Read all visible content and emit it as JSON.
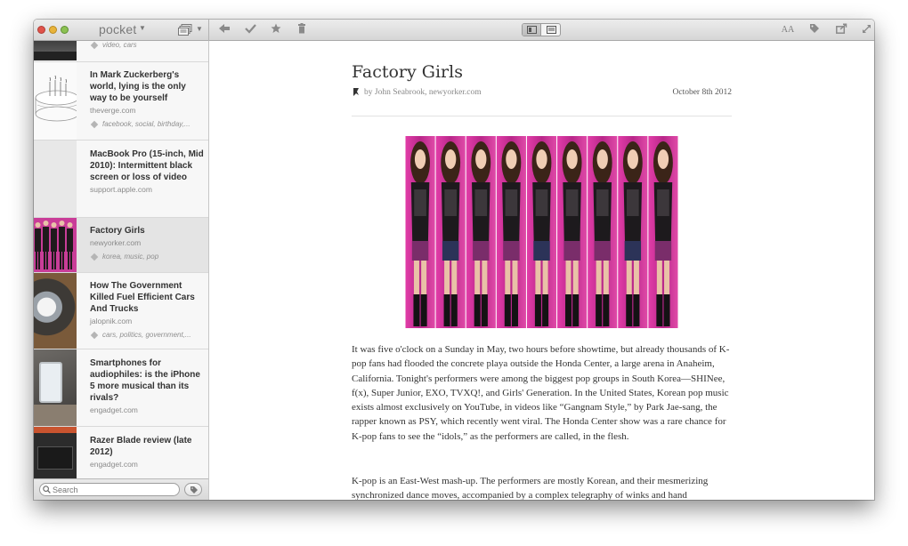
{
  "app": {
    "title": "pocket"
  },
  "toolbar": {
    "buttons": [
      "back-icon",
      "mark-read-icon",
      "favorite-icon",
      "delete-icon"
    ],
    "right_buttons": [
      "text-size-icon",
      "tag-icon",
      "share-icon",
      "fullscreen-icon"
    ],
    "text_size_label": "AA"
  },
  "sidebar": {
    "items": [
      {
        "title": "",
        "domain": "",
        "tags": "video, cars"
      },
      {
        "title": "In Mark Zuckerberg's world, lying is the only way to be yourself",
        "domain": "theverge.com",
        "tags": "facebook, social, birthday,..."
      },
      {
        "title": "MacBook Pro (15-inch, Mid 2010): Intermittent black screen or loss of video",
        "domain": "support.apple.com",
        "tags": ""
      },
      {
        "title": "Factory Girls",
        "domain": "newyorker.com",
        "tags": "korea, music, pop"
      },
      {
        "title": "How The Government Killed Fuel Efficient Cars And Trucks",
        "domain": "jalopnik.com",
        "tags": "cars, politics, government,..."
      },
      {
        "title": "Smartphones for audiophiles: is the iPhone 5 more musical than its rivals?",
        "domain": "engadget.com",
        "tags": ""
      },
      {
        "title": "Razer Blade review (late 2012)",
        "domain": "engadget.com",
        "tags": ""
      }
    ],
    "search": {
      "placeholder": "Search"
    }
  },
  "article": {
    "title": "Factory Girls",
    "byline": "by John Seabrook, newyorker.com",
    "date": "October 8th 2012",
    "paragraphs": [
      "It was five o'clock on a Sunday in May, two hours before showtime, but already thousands of K-pop fans had flooded the concrete playa outside the Honda Center, a large arena in Anaheim, California. Tonight's performers were among the biggest pop groups in South Korea—SHINee, f(x), Super Junior, EXO, TVXQ!, and Girls' Generation. In the United States, Korean pop music exists almost exclusively on YouTube, in videos like “Gangnam Style,” by Park Jae-sang, the rapper known as PSY, which recently went viral. The Honda Center show was a rare chance for K-pop fans to see the “idols,” as the performers are called, in the flesh.",
      "K-pop is an East-West mash-up. The performers are mostly Korean, and their mesmerizing synchronized dance moves, accompanied by a complex telegraphy of winks and hand"
    ]
  },
  "colors": {
    "accent_pink": "#c8389a",
    "selected_row": "#e4e4e4"
  }
}
